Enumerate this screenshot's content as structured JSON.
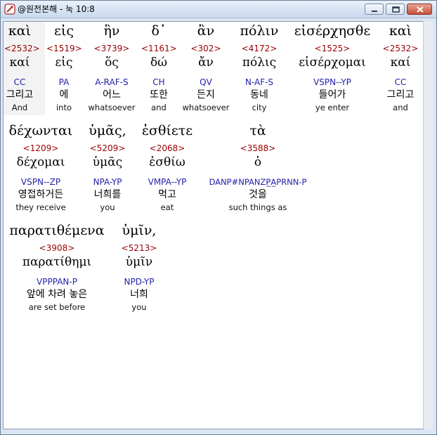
{
  "window": {
    "title": "@원전본해 - 눅 10:8"
  },
  "rows": [
    {
      "words": [
        {
          "greek": "καὶ",
          "num": "<2532>",
          "lemma": "καί",
          "parse": "CC",
          "kor": "그리고",
          "eng": "And"
        },
        {
          "greek": "εἰς",
          "num": "<1519>",
          "lemma": "εἰς",
          "parse": "PA",
          "kor": "에",
          "eng": "into"
        },
        {
          "greek": "ἣν",
          "num": "<3739>",
          "lemma": "ὅς",
          "parse": "A-RAF-S",
          "kor": "어느",
          "eng": "whatsoever"
        },
        {
          "greek": "δ᾽",
          "num": "<1161>",
          "lemma": "δώ",
          "parse": "CH",
          "kor": "또한",
          "eng": "and"
        },
        {
          "greek": "ἂν",
          "num": "<302>",
          "lemma": "ἄν",
          "parse": "QV",
          "kor": "든지",
          "eng": "whatsoever"
        },
        {
          "greek": "πόλιν",
          "num": "<4172>",
          "lemma": "πόλις",
          "parse": "N-AF-S",
          "kor": "동네",
          "eng": "city"
        },
        {
          "greek": "εἰσέρχησθε",
          "num": "<1525>",
          "lemma": "εἰσέρχομαι",
          "parse": "VSPN--YP",
          "kor": "들어가",
          "eng": "ye enter"
        },
        {
          "greek": "καὶ",
          "num": "<2532>",
          "lemma": "καί",
          "parse": "CC",
          "kor": "그리고",
          "eng": "and"
        }
      ]
    },
    {
      "words": [
        {
          "greek": "δέχωνται",
          "num": "<1209>",
          "lemma": "δέχομαι",
          "parse": "VSPN--ZP",
          "kor": "영접하거든",
          "eng": "they receive"
        },
        {
          "greek": "ὑμᾶς,",
          "num": "<5209>",
          "lemma": "ὑμᾶς",
          "parse": "NPA-YP",
          "kor": "너희를",
          "eng": "you"
        },
        {
          "greek": "ἐσθίετε",
          "num": "<2068>",
          "lemma": "ἐσθίω",
          "parse": "VMPA--YP",
          "kor": "먹고",
          "eng": "eat"
        },
        {
          "greek": "τὰ",
          "num": "<3588>",
          "lemma": "ὁ",
          "parse": "DANP#NPANZP̲A̲PRNN-P",
          "kor": "것을",
          "eng": "such things as"
        }
      ]
    },
    {
      "words": [
        {
          "greek": "παρατιθέμενα",
          "num": "<3908>",
          "lemma": "παρατίθημι",
          "parse": "VPPPAN-P",
          "kor": "앞에 차려 놓은",
          "eng": "are set before"
        },
        {
          "greek": "ὑμῖν,",
          "num": "<5213>",
          "lemma": "ὑμῖν",
          "parse": "NPD-YP",
          "kor": "너희",
          "eng": "you"
        }
      ]
    }
  ]
}
